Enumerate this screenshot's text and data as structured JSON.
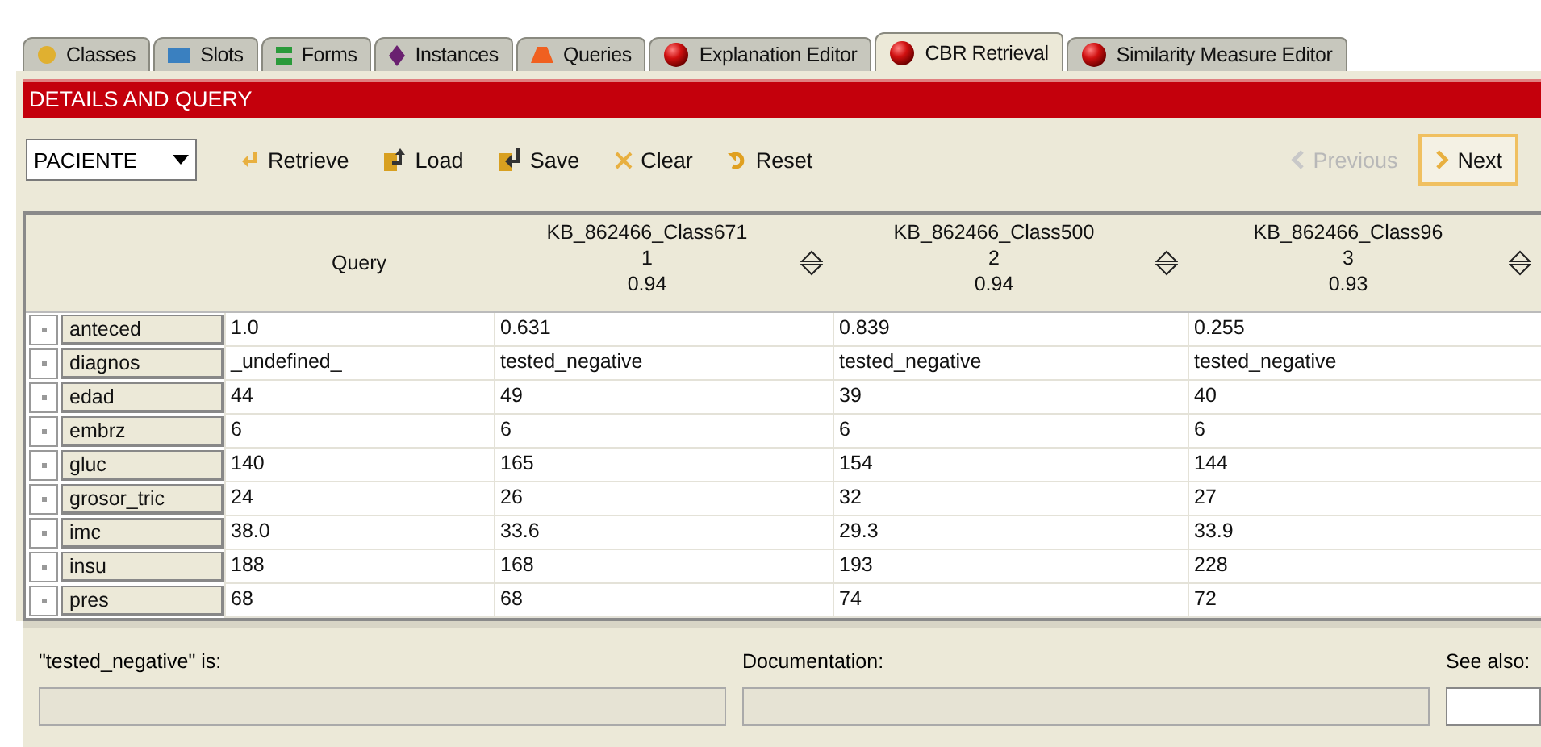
{
  "tabs": [
    {
      "label": "Classes",
      "kind": "circle",
      "selected": false
    },
    {
      "label": "Slots",
      "kind": "rect",
      "selected": false
    },
    {
      "label": "Forms",
      "kind": "bars",
      "selected": false
    },
    {
      "label": "Instances",
      "kind": "diamond",
      "selected": false
    },
    {
      "label": "Queries",
      "kind": "trapezoid",
      "selected": false
    },
    {
      "label": "Explanation Editor",
      "kind": "ball",
      "selected": false
    },
    {
      "label": "CBR Retrieval",
      "kind": "ball",
      "selected": true
    },
    {
      "label": "Similarity Measure Editor",
      "kind": "ball",
      "selected": false
    }
  ],
  "panel_title": "DETAILS AND QUERY",
  "toolbar": {
    "class_select": "PACIENTE",
    "buttons": [
      {
        "label": "Retrieve",
        "kind": "retrieve"
      },
      {
        "label": "Load",
        "kind": "load"
      },
      {
        "label": "Save",
        "kind": "save"
      },
      {
        "label": "Clear",
        "kind": "clear"
      },
      {
        "label": "Reset",
        "kind": "reset"
      }
    ],
    "previous": {
      "label": "Previous",
      "disabled": true
    },
    "next": {
      "label": "Next",
      "disabled": false
    }
  },
  "table": {
    "query_header": "Query",
    "cases": [
      {
        "name": "KB_862466_Class671",
        "rank": "1",
        "score": "0.94"
      },
      {
        "name": "KB_862466_Class500",
        "rank": "2",
        "score": "0.94"
      },
      {
        "name": "KB_862466_Class96",
        "rank": "3",
        "score": "0.93"
      }
    ],
    "rows": [
      {
        "attribute": "anteced",
        "query": "1.0",
        "values": [
          "0.631",
          "0.839",
          "0.255"
        ]
      },
      {
        "attribute": "diagnos",
        "query": "_undefined_",
        "values": [
          "tested_negative",
          "tested_negative",
          "tested_negative"
        ]
      },
      {
        "attribute": "edad",
        "query": "44",
        "values": [
          "49",
          "39",
          "40"
        ]
      },
      {
        "attribute": "embrz",
        "query": "6",
        "values": [
          "6",
          "6",
          "6"
        ]
      },
      {
        "attribute": "gluc",
        "query": "140",
        "values": [
          "165",
          "154",
          "144"
        ]
      },
      {
        "attribute": "grosor_tric",
        "query": "24",
        "values": [
          "26",
          "32",
          "27"
        ]
      },
      {
        "attribute": "imc",
        "query": "38.0",
        "values": [
          "33.6",
          "29.3",
          "33.9"
        ]
      },
      {
        "attribute": "insu",
        "query": "188",
        "values": [
          "168",
          "193",
          "228"
        ]
      },
      {
        "attribute": "pres",
        "query": "68",
        "values": [
          "68",
          "74",
          "72"
        ]
      }
    ]
  },
  "info": {
    "value_label": "\"tested_negative\" is:",
    "documentation_label": "Documentation:",
    "see_also_label": "See also:"
  }
}
